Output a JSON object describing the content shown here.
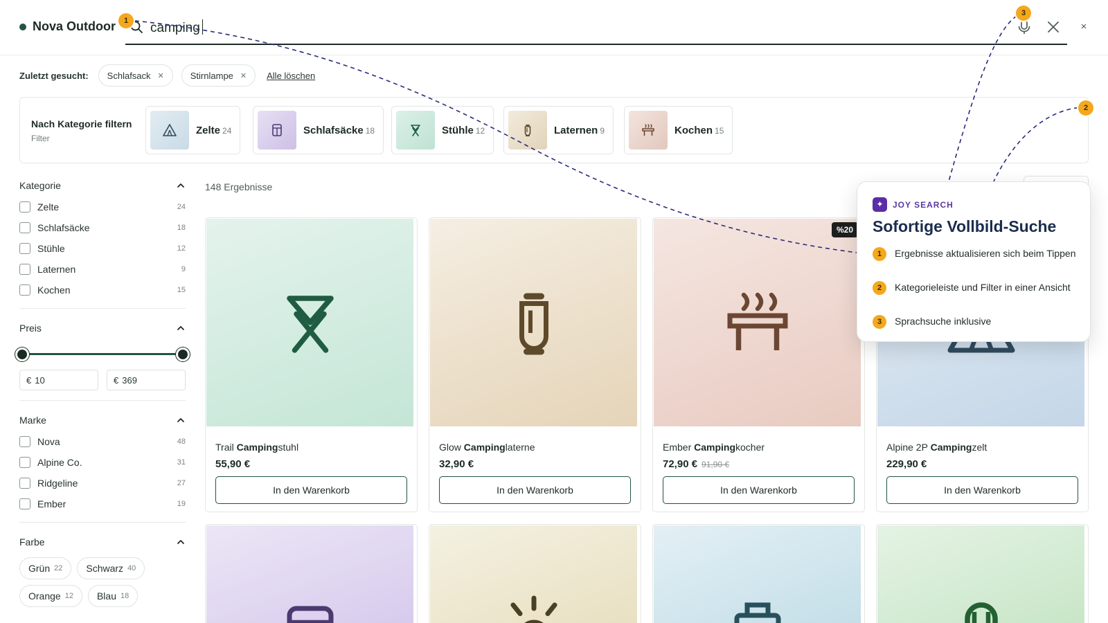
{
  "brand": {
    "name": "Nova Outdoor"
  },
  "search": {
    "query": "camping"
  },
  "recent": {
    "label": "Zuletzt gesucht:",
    "items": [
      "Schlafsack",
      "Stirnlampe"
    ],
    "clear_all": "Alle löschen"
  },
  "category_strip": {
    "title": "Nach Kategorie filtern",
    "subtitle": "Filter",
    "items": [
      {
        "name": "Zelte",
        "count": "24",
        "icon": "tent-icon",
        "color": "#d5e3ec"
      },
      {
        "name": "Schlafsäcke",
        "count": "18",
        "icon": "sleeping-bag-icon",
        "color": "#ddd4ee"
      },
      {
        "name": "Stühle",
        "count": "12",
        "icon": "chair-icon",
        "color": "#d3ece2"
      },
      {
        "name": "Laternen",
        "count": "9",
        "icon": "lantern-icon",
        "color": "#ece3d3"
      },
      {
        "name": "Kochen",
        "count": "15",
        "icon": "stove-icon",
        "color": "#eddcd5"
      }
    ]
  },
  "sidebar": {
    "category": {
      "title": "Kategorie",
      "options": [
        {
          "label": "Zelte",
          "count": "24"
        },
        {
          "label": "Schlafsäcke",
          "count": "18"
        },
        {
          "label": "Stühle",
          "count": "12"
        },
        {
          "label": "Laternen",
          "count": "9"
        },
        {
          "label": "Kochen",
          "count": "15"
        }
      ]
    },
    "price": {
      "title": "Preis",
      "currency": "€",
      "min": "10",
      "max": "369"
    },
    "brand": {
      "title": "Marke",
      "options": [
        {
          "label": "Nova",
          "count": "48"
        },
        {
          "label": "Alpine Co.",
          "count": "31"
        },
        {
          "label": "Ridgeline",
          "count": "27"
        },
        {
          "label": "Ember",
          "count": "19"
        }
      ]
    },
    "color": {
      "title": "Farbe",
      "options": [
        {
          "label": "Grün",
          "count": "22"
        },
        {
          "label": "Schwarz",
          "count": "40"
        },
        {
          "label": "Orange",
          "count": "12"
        },
        {
          "label": "Blau",
          "count": "18"
        }
      ]
    }
  },
  "results": {
    "count_label": "148 Ergebnisse",
    "add_to_cart": "In den Warenkorb",
    "products": [
      {
        "prefix": "Trail ",
        "highlight": "Camping",
        "suffix": "stuhl",
        "price": "55,90 €",
        "old_price": "",
        "icon": "chair-icon",
        "color": "#1f5c42"
      },
      {
        "prefix": "Glow ",
        "highlight": "Camping",
        "suffix": "laterne",
        "price": "32,90 €",
        "old_price": "",
        "icon": "lantern-icon",
        "color": "#5e4a2a"
      },
      {
        "prefix": "Ember ",
        "highlight": "Camping",
        "suffix": "kocher",
        "price": "72,90 €",
        "old_price": "91,90 €",
        "badge": "%20",
        "icon": "stove-icon",
        "color": "#6b4632"
      },
      {
        "prefix": "Alpine 2P ",
        "highlight": "Camping",
        "suffix": "zelt",
        "price": "229,90 €",
        "old_price": "",
        "icon": "tent-icon",
        "color": "#2f4a5e"
      }
    ]
  },
  "popup": {
    "tag": "JOY SEARCH",
    "title": "Sofortige Vollbild-Suche",
    "items": [
      {
        "num": "1",
        "text": "Ergebnisse aktualisieren sich beim Tippen"
      },
      {
        "num": "2",
        "text": "Kategorieleiste und Filter in einer Ansicht"
      },
      {
        "num": "3",
        "text": "Sprachsuche inklusive"
      }
    ]
  },
  "markers": [
    "1",
    "2",
    "3"
  ]
}
